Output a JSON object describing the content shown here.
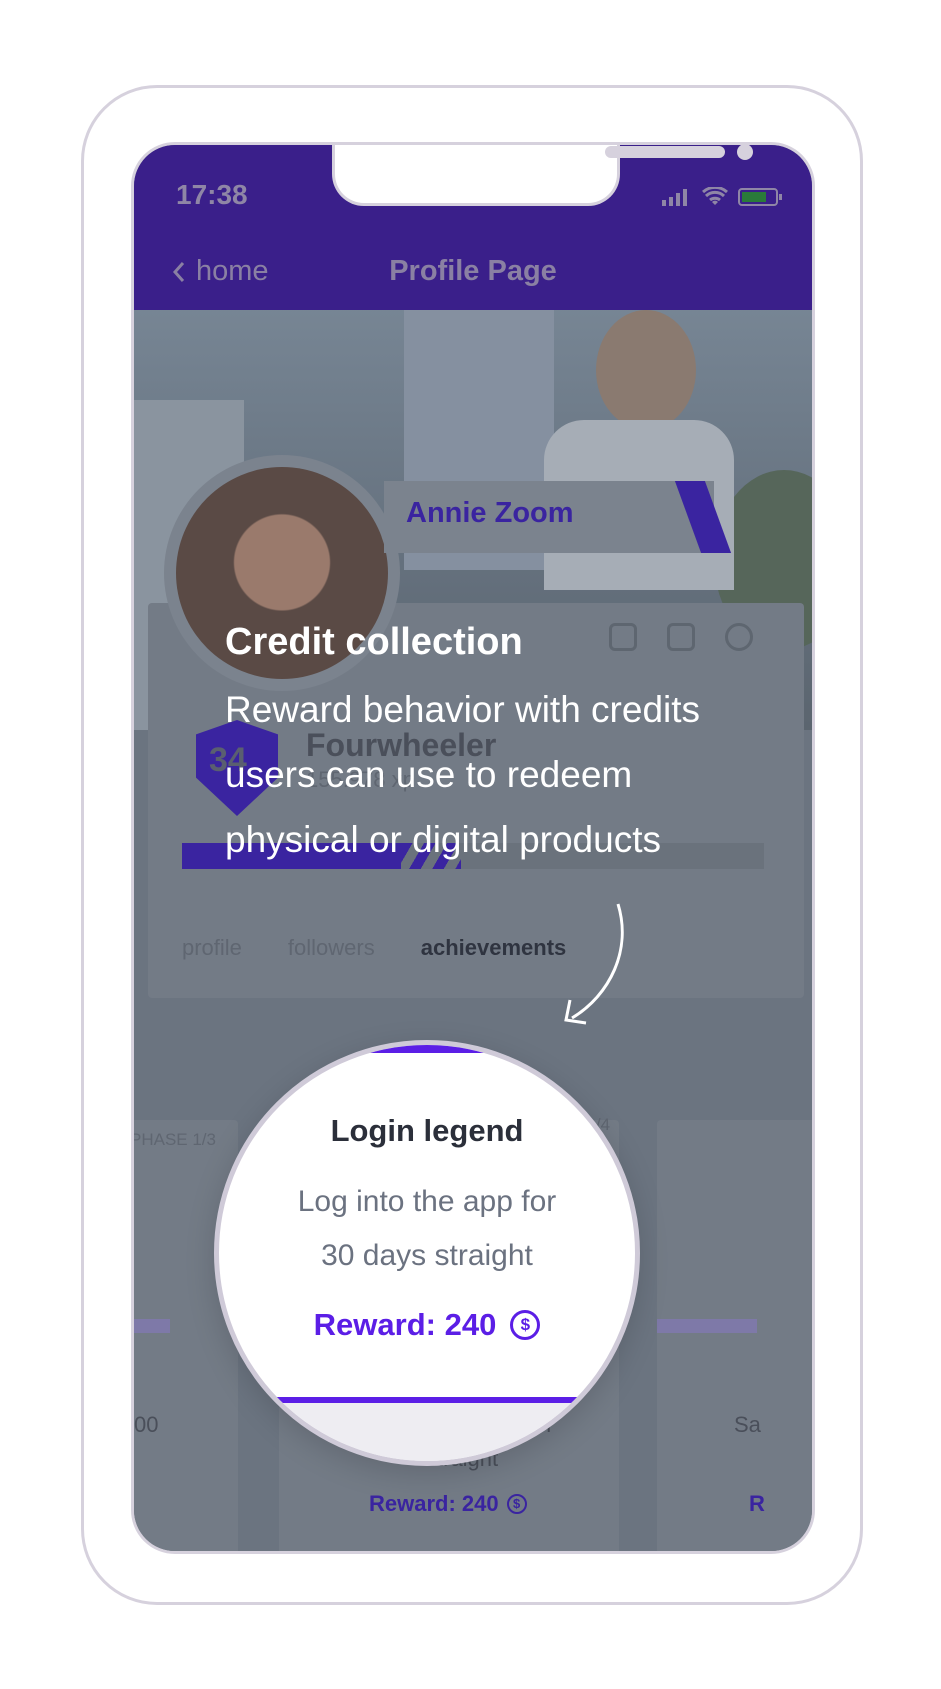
{
  "status": {
    "time": "17:38"
  },
  "nav": {
    "back_label": "home",
    "title": "Profile Page"
  },
  "profile": {
    "name": "Annie Zoom",
    "level_number": "34",
    "level_title": "Fourwheeler",
    "xp": "155.978 xp",
    "progress": 0.48
  },
  "tabs": [
    "profile",
    "followers",
    "achievements"
  ],
  "active_tab": "achievements",
  "background_cards": {
    "left_phase": "PHASE 1/3",
    "right_phase": "SE 1/4",
    "left_partial_value": "00",
    "right_partial_text": "Sa",
    "right_partial_reward": "R",
    "center_partial_line1": "or",
    "center_partial_line2": "straight",
    "center_reward": "Reward: 240"
  },
  "tooltip": {
    "title": "Credit collection",
    "body": "Reward behavior with credits users can use to redeem physical or digital products"
  },
  "magnifier": {
    "title": "Login legend",
    "description_line1": "Log into the app for",
    "description_line2": "30 days straight",
    "reward": "Reward: 240",
    "coin_symbol": "$"
  },
  "colors": {
    "brand": "#3a1f8a",
    "accent": "#5b1ee6"
  },
  "icons": [
    "back-chevron-icon",
    "signal-icon",
    "wifi-icon",
    "battery-icon",
    "twitch-icon",
    "instagram-icon",
    "twitter-icon",
    "coin-icon",
    "curved-arrow-icon"
  ]
}
